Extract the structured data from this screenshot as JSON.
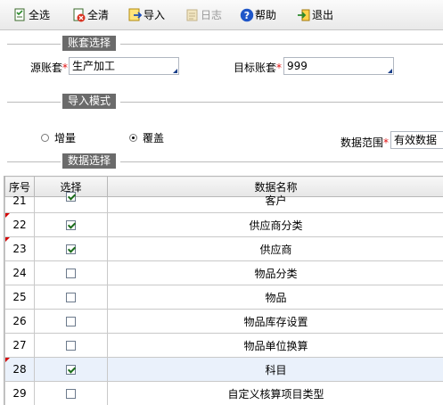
{
  "toolbar": {
    "select_all": "全选",
    "clear_all": "全清",
    "import": "导入",
    "log": "日志",
    "help": "帮助",
    "exit": "退出"
  },
  "sections": {
    "account": "账套选择",
    "import_mode": "导入模式",
    "data_select": "数据选择"
  },
  "form": {
    "source_label": "源账套",
    "source_value": "生产加工",
    "target_label": "目标账套",
    "target_value": "999",
    "required_mark": "*",
    "mode_increment": "增量",
    "mode_overwrite": "覆盖",
    "mode_selected": "覆盖",
    "range_label": "数据范围",
    "range_value": "有效数据"
  },
  "grid": {
    "columns": [
      "序号",
      "选择",
      "数据名称"
    ],
    "rows": [
      {
        "no": "21",
        "checked": true,
        "name": "客户",
        "flag": false,
        "selected": false
      },
      {
        "no": "22",
        "checked": true,
        "name": "供应商分类",
        "flag": true,
        "selected": false
      },
      {
        "no": "23",
        "checked": true,
        "name": "供应商",
        "flag": true,
        "selected": false
      },
      {
        "no": "24",
        "checked": false,
        "name": "物品分类",
        "flag": false,
        "selected": false
      },
      {
        "no": "25",
        "checked": false,
        "name": "物品",
        "flag": false,
        "selected": false
      },
      {
        "no": "26",
        "checked": false,
        "name": "物品库存设置",
        "flag": false,
        "selected": false
      },
      {
        "no": "27",
        "checked": false,
        "name": "物品单位换算",
        "flag": false,
        "selected": false
      },
      {
        "no": "28",
        "checked": true,
        "name": "科目",
        "flag": true,
        "selected": true
      },
      {
        "no": "29",
        "checked": false,
        "name": "自定义核算项目类型",
        "flag": false,
        "selected": false
      }
    ]
  },
  "colors": {
    "section_tag_bg": "#6b6b6b",
    "required_star": "#e01010",
    "row_selected": "#eaf1fb",
    "row_flag": "#d40000"
  },
  "icons": [
    "select-all-icon",
    "clear-all-icon",
    "import-icon",
    "log-icon",
    "help-icon",
    "exit-icon"
  ]
}
